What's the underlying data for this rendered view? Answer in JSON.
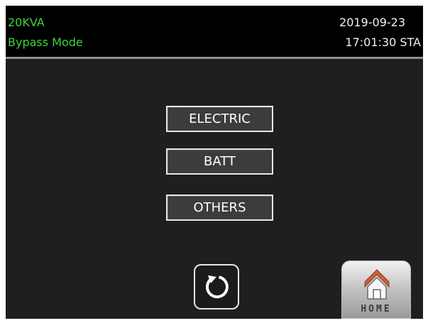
{
  "header": {
    "model": "20KVA",
    "mode": "Bypass Mode",
    "date": "2019-09-23",
    "time": "17:01:30 STA"
  },
  "menu": {
    "items": [
      {
        "label": "ELECTRIC"
      },
      {
        "label": "BATT"
      },
      {
        "label": "OTHERS"
      }
    ]
  },
  "footer": {
    "refresh_icon": "refresh-icon",
    "home_icon": "house-icon",
    "home_label": "HOME"
  },
  "colors": {
    "screen_background": "#1f1f1f",
    "header_background": "#000000",
    "status_text": "#3cd43c",
    "clock_text": "#f2f2f2",
    "button_border": "#e6e6e6",
    "button_fill": "#3c3c3c",
    "house_roof": "#c7603c"
  }
}
